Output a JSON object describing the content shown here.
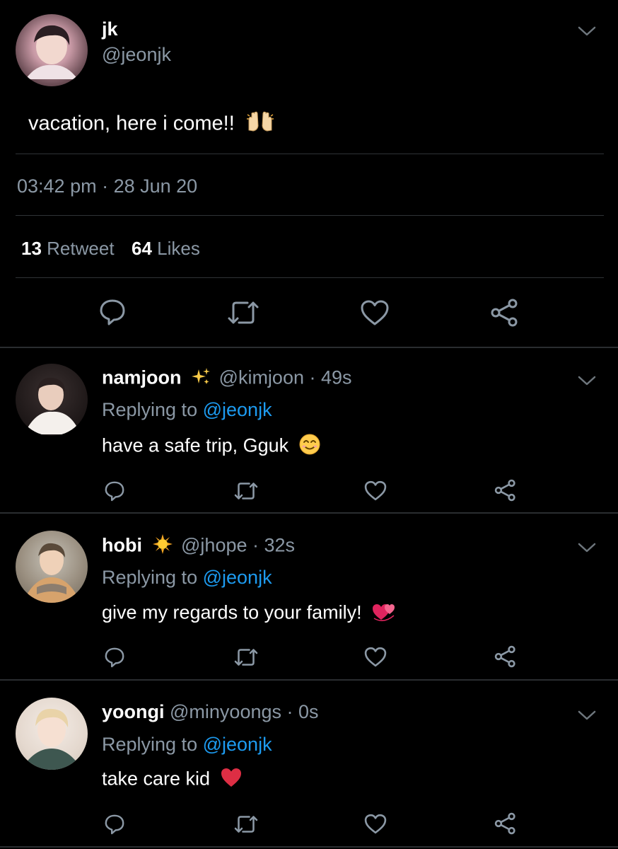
{
  "main_tweet": {
    "display_name": "jk",
    "handle": "@jeonjk",
    "text": "vacation, here i come!!",
    "text_emoji": "raising-hands",
    "timestamp": "03:42 pm · 28 Jun 20",
    "retweet_count": "13",
    "retweet_label": "Retweet",
    "likes_count": "64",
    "likes_label": "Likes"
  },
  "replies": [
    {
      "display_name": "namjoon",
      "name_emoji": "sparkles",
      "meta": "@kimjoon · 49s",
      "replying_prefix": "Replying to",
      "replying_handle": "@jeonjk",
      "text": "have a safe trip, Gguk",
      "text_emoji": "smiling-face"
    },
    {
      "display_name": "hobi",
      "name_emoji": "sun",
      "meta": "@jhope · 32s",
      "replying_prefix": "Replying to",
      "replying_handle": "@jeonjk",
      "text": "give my regards to your family!",
      "text_emoji": "two-hearts"
    },
    {
      "display_name": "yoongi",
      "name_emoji": "",
      "meta": "@minyoongs · 0s",
      "replying_prefix": "Replying to",
      "replying_handle": "@jeonjk",
      "text": "take care kid",
      "text_emoji": "red-heart"
    }
  ],
  "colors": {
    "background": "#000000",
    "muted": "#8b98a5",
    "link": "#1d9bf0",
    "divider": "#2f3336"
  }
}
